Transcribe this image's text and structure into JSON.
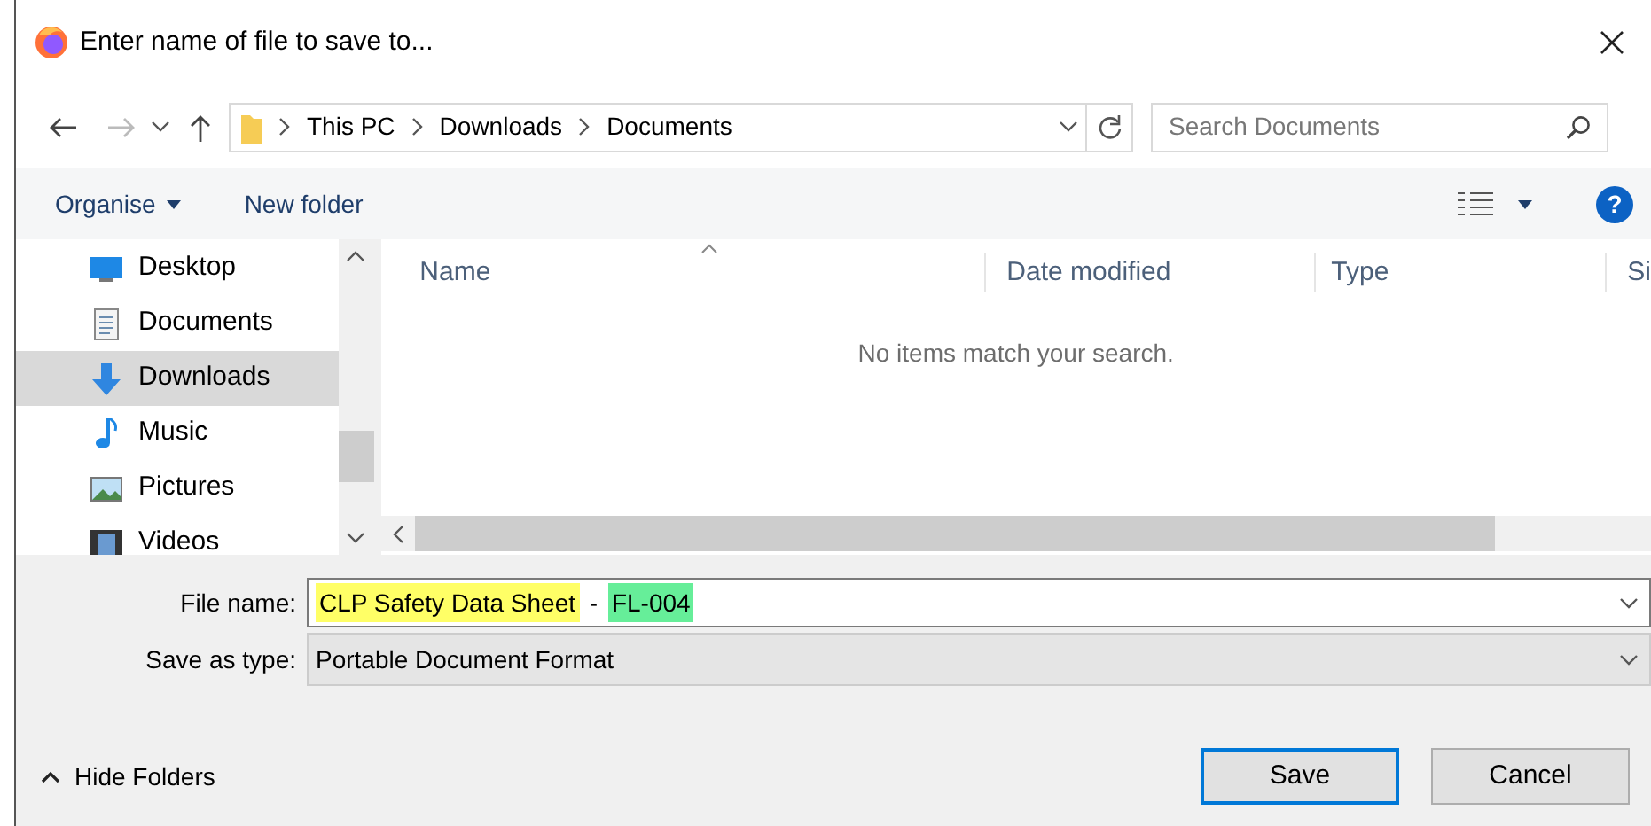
{
  "window": {
    "title": "Enter name of file to save to..."
  },
  "address_bar": {
    "path": [
      "This PC",
      "Downloads",
      "Documents"
    ]
  },
  "search": {
    "placeholder": "Search Documents"
  },
  "toolbar": {
    "organise": "Organise",
    "new_folder": "New folder",
    "help": "?"
  },
  "sidebar": {
    "items": [
      {
        "label": "Desktop",
        "kind": "desktop",
        "selected": false
      },
      {
        "label": "Documents",
        "kind": "document",
        "selected": false
      },
      {
        "label": "Downloads",
        "kind": "download",
        "selected": true
      },
      {
        "label": "Music",
        "kind": "music",
        "selected": false
      },
      {
        "label": "Pictures",
        "kind": "pictures",
        "selected": false
      },
      {
        "label": "Videos",
        "kind": "videos",
        "selected": false
      }
    ]
  },
  "table": {
    "columns": [
      "Name",
      "Date modified",
      "Type",
      "Si"
    ],
    "empty_message": "No items match your search."
  },
  "file_name": {
    "label": "File name:",
    "segments": [
      {
        "text": "CLP Safety Data Sheet",
        "color": "#ffff66"
      },
      {
        "text": " - "
      },
      {
        "text": "FL-004",
        "color": "#66ee99"
      }
    ]
  },
  "save_as_type": {
    "label": "Save as type:",
    "value": "Portable Document Format"
  },
  "hide_folders": "Hide Folders",
  "buttons": [
    {
      "label": "Save",
      "default": true
    },
    {
      "label": "Cancel",
      "default": false
    }
  ]
}
